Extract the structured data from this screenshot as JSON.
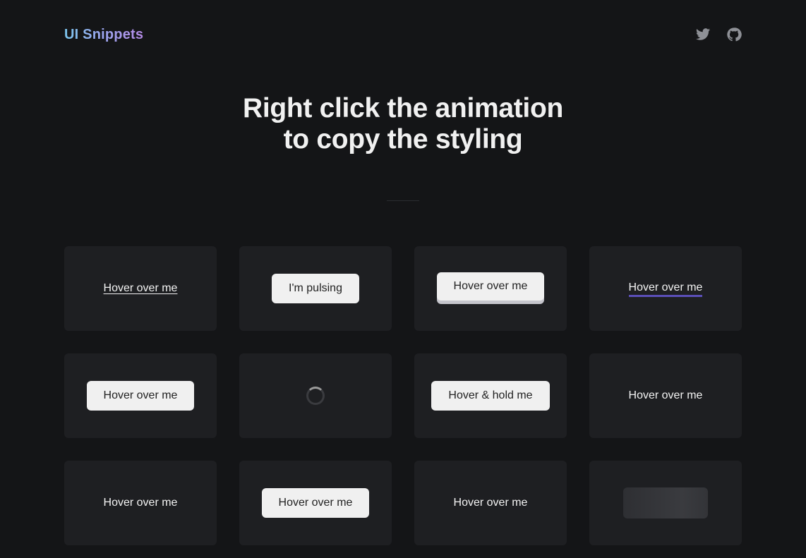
{
  "header": {
    "logo": "UI Snippets",
    "social": [
      {
        "icon": "twitter-icon"
      },
      {
        "icon": "github-icon"
      }
    ]
  },
  "hero": {
    "line1": "Right click the animation",
    "line2": "to copy the styling"
  },
  "cards": [
    {
      "label": "Hover over me",
      "style": "underline-link"
    },
    {
      "label": "I'm pulsing",
      "style": "pulse-button"
    },
    {
      "label": "Hover over me",
      "style": "3d-button"
    },
    {
      "label": "Hover over me",
      "style": "gradient-underline-link"
    },
    {
      "label": "Hover over me",
      "style": "light-button"
    },
    {
      "label": "",
      "style": "spinner"
    },
    {
      "label": "Hover & hold me",
      "style": "hold-button"
    },
    {
      "label": "Hover over me",
      "style": "plain-text"
    },
    {
      "label": "Hover over me",
      "style": "plain-text"
    },
    {
      "label": "Hover over me",
      "style": "light-button"
    },
    {
      "label": "Hover over me",
      "style": "plain-text"
    },
    {
      "label": "",
      "style": "skeleton"
    }
  ],
  "colors": {
    "background": "#141517",
    "card": "#1e1f22",
    "accent_purple": "#5b4fb8",
    "logo_gradient_start": "#7cc6ee",
    "logo_gradient_end": "#b48ae6"
  }
}
